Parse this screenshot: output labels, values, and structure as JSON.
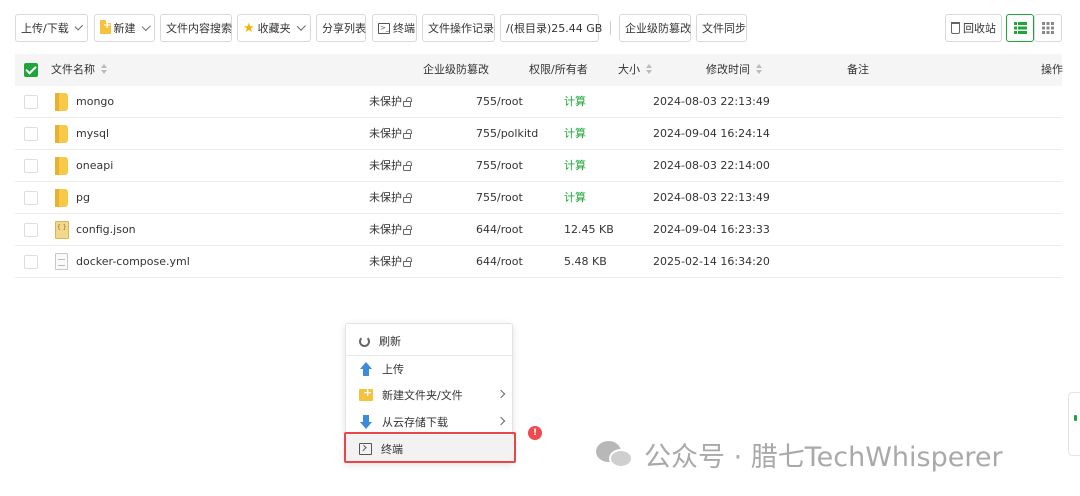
{
  "toolbar": {
    "upload_download": "上传/下载",
    "new": "新建",
    "content_search": "文件内容搜索",
    "favorites": "收藏夹",
    "share_list": "分享列表",
    "terminal": "终端",
    "op_log": "文件操作记录",
    "disk": "/(根目录)25.44 GB",
    "tamper": "企业级防篡改",
    "sync": "文件同步",
    "recycle": "回收站"
  },
  "table": {
    "headers": {
      "name": "文件名称",
      "tamper": "企业级防篡改",
      "perm": "权限/所有者",
      "size": "大小",
      "mtime": "修改时间",
      "note": "备注",
      "action": "操作"
    },
    "rows": [
      {
        "name": "mongo",
        "type": "folder",
        "protect": "未保护",
        "perm": "755/root",
        "size": "计算",
        "mtime": "2024-08-03 22:13:49"
      },
      {
        "name": "mysql",
        "type": "folder",
        "protect": "未保护",
        "perm": "755/polkitd",
        "size": "计算",
        "mtime": "2024-09-04 16:24:14"
      },
      {
        "name": "oneapi",
        "type": "folder",
        "protect": "未保护",
        "perm": "755/root",
        "size": "计算",
        "mtime": "2024-08-03 22:14:00"
      },
      {
        "name": "pg",
        "type": "folder",
        "protect": "未保护",
        "perm": "755/root",
        "size": "计算",
        "mtime": "2024-08-03 22:13:49"
      },
      {
        "name": "config.json",
        "type": "json",
        "protect": "未保护",
        "perm": "644/root",
        "size": "12.45 KB",
        "mtime": "2024-09-04 16:23:33"
      },
      {
        "name": "docker-compose.yml",
        "type": "file",
        "protect": "未保护",
        "perm": "644/root",
        "size": "5.48 KB",
        "mtime": "2025-02-14 16:34:20"
      }
    ]
  },
  "context_menu": {
    "refresh": "刷新",
    "upload": "上传",
    "new_folder_file": "新建文件夹/文件",
    "cloud_download": "从云存储下载",
    "terminal": "终端"
  },
  "badge": "!",
  "watermark": "公众号 · 腊七TechWhisperer",
  "colors": {
    "accent": "#20a53a",
    "highlight": "#e8464a",
    "icon_blue": "#3c8cde",
    "folder": "#f5c23e"
  }
}
